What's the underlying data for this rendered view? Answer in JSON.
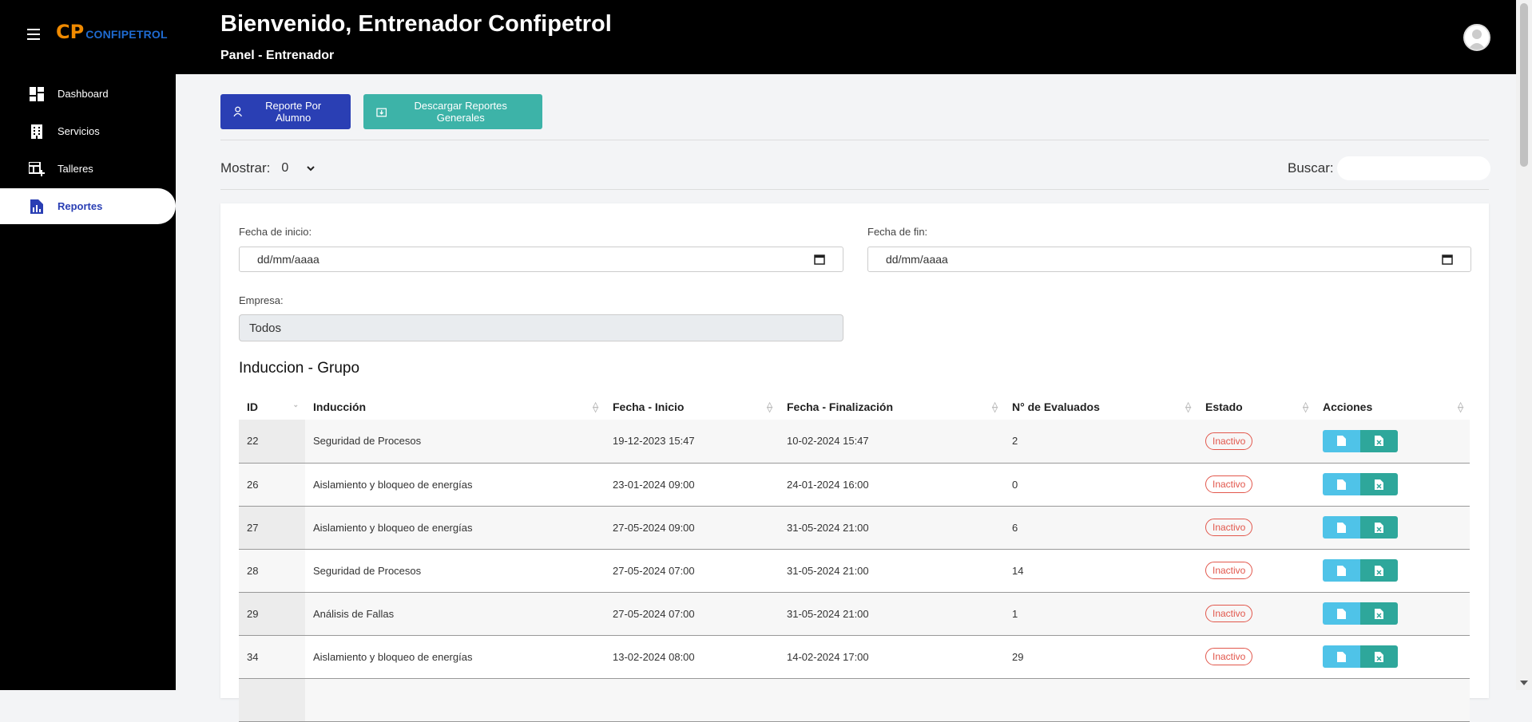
{
  "brand": {
    "mark": "CP",
    "name": "CONFIPETROL",
    "mark_color": "#f08a00",
    "name_color": "#1f6bd1"
  },
  "sidebar": {
    "items": [
      {
        "label": "Dashboard",
        "icon": "dashboard-icon"
      },
      {
        "label": "Servicios",
        "icon": "building-icon"
      },
      {
        "label": "Talleres",
        "icon": "table-add-icon"
      },
      {
        "label": "Reportes",
        "icon": "report-icon",
        "active": true
      }
    ]
  },
  "header": {
    "title": "Bienvenido, Entrenador Confipetrol",
    "subtitle": "Panel - Entrenador"
  },
  "actions": {
    "report_by_student": "Reporte Por Alumno",
    "download_general": "Descargar Reportes Generales"
  },
  "controls": {
    "show_label": "Mostrar:",
    "show_value": "0",
    "search_label": "Buscar:",
    "search_value": ""
  },
  "filters": {
    "start_label": "Fecha de inicio:",
    "start_placeholder": "dd/mm/aaaa",
    "end_label": "Fecha de fin:",
    "end_placeholder": "dd/mm/aaaa",
    "company_label": "Empresa:",
    "company_value": "Todos"
  },
  "table": {
    "title": "Induccion - Grupo",
    "columns": [
      "ID",
      "Inducción",
      "Fecha - Inicio",
      "Fecha - Finalización",
      "N° de Evaluados",
      "Estado",
      "Acciones"
    ],
    "rows": [
      {
        "id": "22",
        "induccion": "Seguridad de Procesos",
        "inicio": "19-12-2023 15:47",
        "fin": "10-02-2024 15:47",
        "evaluados": "2",
        "estado": "Inactivo"
      },
      {
        "id": "26",
        "induccion": "Aislamiento y bloqueo de energías",
        "inicio": "23-01-2024 09:00",
        "fin": "24-01-2024 16:00",
        "evaluados": "0",
        "estado": "Inactivo"
      },
      {
        "id": "27",
        "induccion": "Aislamiento y bloqueo de energías",
        "inicio": "27-05-2024 09:00",
        "fin": "31-05-2024 21:00",
        "evaluados": "6",
        "estado": "Inactivo"
      },
      {
        "id": "28",
        "induccion": "Seguridad de Procesos",
        "inicio": "27-05-2024 07:00",
        "fin": "31-05-2024 21:00",
        "evaluados": "14",
        "estado": "Inactivo"
      },
      {
        "id": "29",
        "induccion": "Análisis de Fallas",
        "inicio": "27-05-2024 07:00",
        "fin": "31-05-2024 21:00",
        "evaluados": "1",
        "estado": "Inactivo"
      },
      {
        "id": "34",
        "induccion": "Aislamiento y bloqueo de energías",
        "inicio": "13-02-2024 08:00",
        "fin": "14-02-2024 17:00",
        "evaluados": "29",
        "estado": "Inactivo"
      },
      {
        "id": "",
        "induccion": "",
        "inicio": "",
        "fin": "",
        "evaluados": "",
        "estado": ""
      }
    ]
  },
  "colors": {
    "primary": "#2a3fb4",
    "teal": "#3db3a8",
    "pdf_button": "#4fc3e8",
    "excel_button": "#2ea79b",
    "inactive": "#e2574c"
  }
}
